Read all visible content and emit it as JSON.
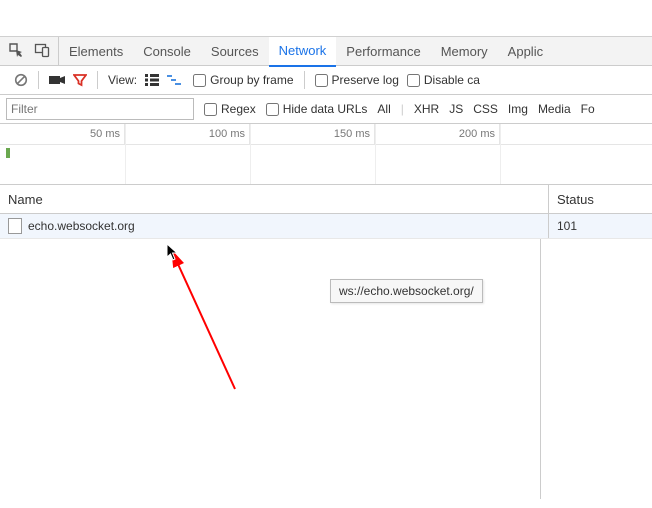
{
  "tabs": {
    "items": [
      {
        "label": "Elements"
      },
      {
        "label": "Console"
      },
      {
        "label": "Sources"
      },
      {
        "label": "Network"
      },
      {
        "label": "Performance"
      },
      {
        "label": "Memory"
      },
      {
        "label": "Applic"
      }
    ],
    "active_index": 3
  },
  "toolbar": {
    "view_label": "View:",
    "group_by_frame": "Group by frame",
    "preserve_log": "Preserve log",
    "disable_cache": "Disable ca"
  },
  "filter_bar": {
    "filter_placeholder": "Filter",
    "regex": "Regex",
    "hide_data_urls": "Hide data URLs",
    "types": [
      "All",
      "XHR",
      "JS",
      "CSS",
      "Img",
      "Media",
      "Fo"
    ]
  },
  "timeline": {
    "ticks": [
      "50 ms",
      "100 ms",
      "150 ms",
      "200 ms"
    ]
  },
  "table": {
    "headers": {
      "name": "Name",
      "status": "Status"
    },
    "rows": [
      {
        "name": "echo.websocket.org",
        "status": "101"
      }
    ]
  },
  "tooltip": {
    "text": "ws://echo.websocket.org/"
  }
}
